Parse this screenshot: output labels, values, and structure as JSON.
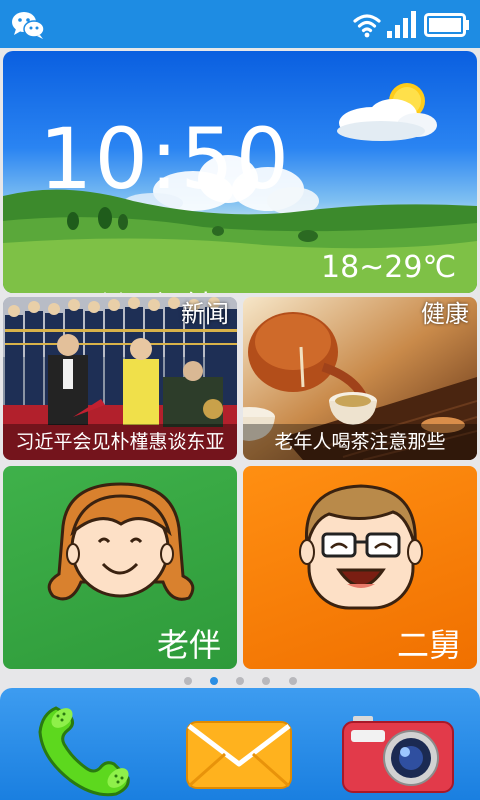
{
  "status_bar": {
    "icons": [
      "wechat-icon",
      "wifi-icon",
      "signal-icon",
      "battery-icon"
    ],
    "color": "#1e8ce3"
  },
  "weather": {
    "time": "10:50",
    "temperature": "18~29℃",
    "city": "上海",
    "alarm_label": "闹钟",
    "condition_icon": "sun-cloud-icon"
  },
  "news": {
    "tag": "新闻",
    "caption": "习近平会见朴槿惠谈东亚"
  },
  "health": {
    "tag": "健康",
    "caption": "老年人喝茶注意那些"
  },
  "contacts": [
    {
      "name": "老伴",
      "color": "#36a542"
    },
    {
      "name": "二舅",
      "color": "#f88208"
    }
  ],
  "pager": {
    "pages": 5,
    "active": 2
  },
  "dock": {
    "apps": [
      "phone-icon",
      "message-icon",
      "camera-icon"
    ],
    "color": "#2a8ee4"
  }
}
